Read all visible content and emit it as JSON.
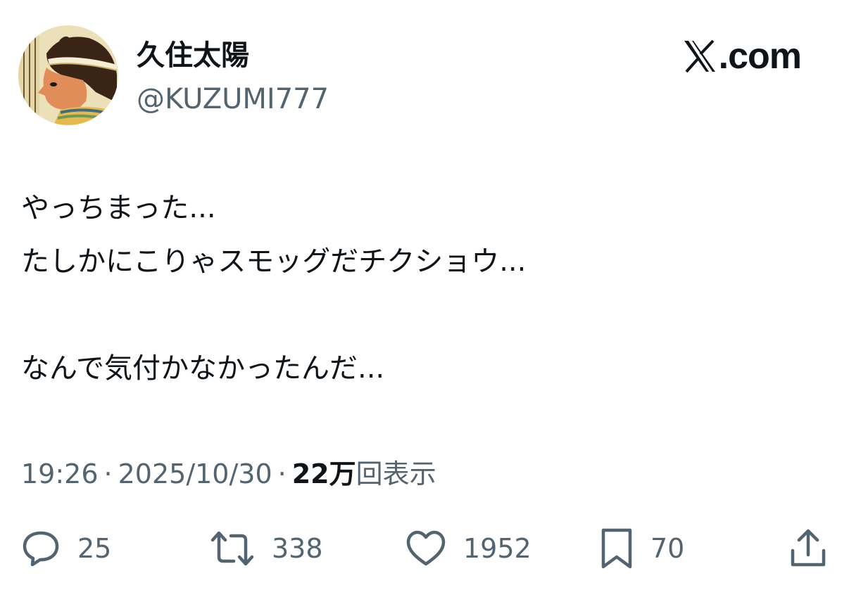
{
  "author": {
    "display_name": "久住太陽",
    "handle": "@KUZUMI777",
    "avatar_icon": "egyptian-profile-avatar"
  },
  "brand": {
    "icon": "x-logo-icon",
    "text": ".com"
  },
  "tweet": {
    "lines": [
      "やっちまった...",
      "たしかにこりゃスモッグだチクショウ...",
      "",
      "なんで気付かなかったんだ..."
    ]
  },
  "meta": {
    "time": "19:26",
    "separator": "·",
    "date": "2025/10/30",
    "views_count": "22万",
    "views_label": "回表示"
  },
  "actions": {
    "reply": {
      "icon": "reply-icon",
      "count": "25"
    },
    "repost": {
      "icon": "repost-icon",
      "count": "338"
    },
    "like": {
      "icon": "heart-icon",
      "count": "1952"
    },
    "bookmark": {
      "icon": "bookmark-icon",
      "count": "70"
    },
    "share": {
      "icon": "share-icon"
    }
  },
  "colors": {
    "text_primary": "#0f1419",
    "text_secondary": "#536471"
  }
}
